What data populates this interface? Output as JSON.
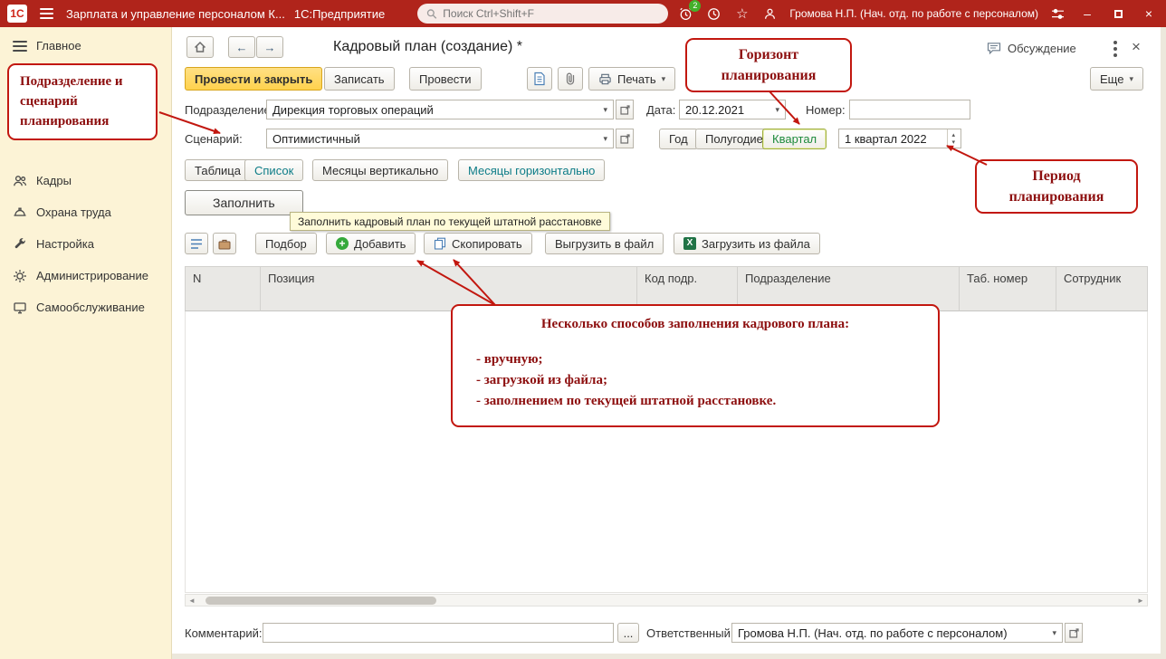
{
  "topbar": {
    "logo": "1С",
    "app_title": "Зарплата и управление персоналом К...",
    "platform": "1С:Предприятие",
    "search_placeholder": "Поиск Ctrl+Shift+F",
    "notification_count": "2",
    "user_name": "Громова Н.П. (Нач. отд. по работе с персоналом)"
  },
  "sidebar": {
    "header": "Главное",
    "items": [
      {
        "label": "Кадры"
      },
      {
        "label": "Охрана труда"
      },
      {
        "label": "Настройка"
      },
      {
        "label": "Администрирование"
      },
      {
        "label": "Самообслуживание"
      }
    ]
  },
  "header": {
    "title": "Кадровый план (создание) *",
    "discussion": "Обсуждение"
  },
  "actions": {
    "post_and_close": "Провести и закрыть",
    "write": "Записать",
    "post": "Провести",
    "print": "Печать",
    "more": "Еще"
  },
  "form": {
    "department": {
      "label": "Подразделение:",
      "value": "Дирекция торговых операций"
    },
    "date": {
      "label": "Дата:",
      "value": "20.12.2021"
    },
    "number": {
      "label": "Номер:",
      "value": ""
    },
    "scenario": {
      "label": "Сценарий:",
      "value": "Оптимистичный"
    },
    "horizon": {
      "year": "Год",
      "half_year": "Полугодие",
      "quarter": "Квартал"
    },
    "period": {
      "value": "1 квартал 2022"
    },
    "views": {
      "table": "Таблица",
      "list": "Список",
      "months_v": "Месяцы вертикально",
      "months_h": "Месяцы горизонтально"
    },
    "fill": {
      "button": "Заполнить",
      "tooltip": "Заполнить кадровый план по текущей штатной расстановке"
    }
  },
  "grid": {
    "toolbar": {
      "pick": "Подбор",
      "add": "Добавить",
      "copy": "Скопировать",
      "export": "Выгрузить в файл",
      "import": "Загрузить из файла"
    },
    "columns": [
      "N",
      "Позиция",
      "Код подр.",
      "Подразделение",
      "Таб. номер",
      "Сотрудник"
    ]
  },
  "footer": {
    "comment": {
      "label": "Комментарий:",
      "value": ""
    },
    "dots": "...",
    "responsible": {
      "label": "Ответственный:",
      "value": "Громова Н.П. (Нач. отд. по работе с персоналом)"
    }
  },
  "callouts": {
    "dept_scenario": "Подразделение и сценарий планирования",
    "horizon": "Горизонт планирования",
    "period": "Период планирования",
    "fill": {
      "title": "Несколько способов заполнения кадрового плана:",
      "items": [
        "- вручную;",
        "- загрузкой из файла;",
        "- заполнением по текущей штатной расстановке."
      ]
    }
  }
}
